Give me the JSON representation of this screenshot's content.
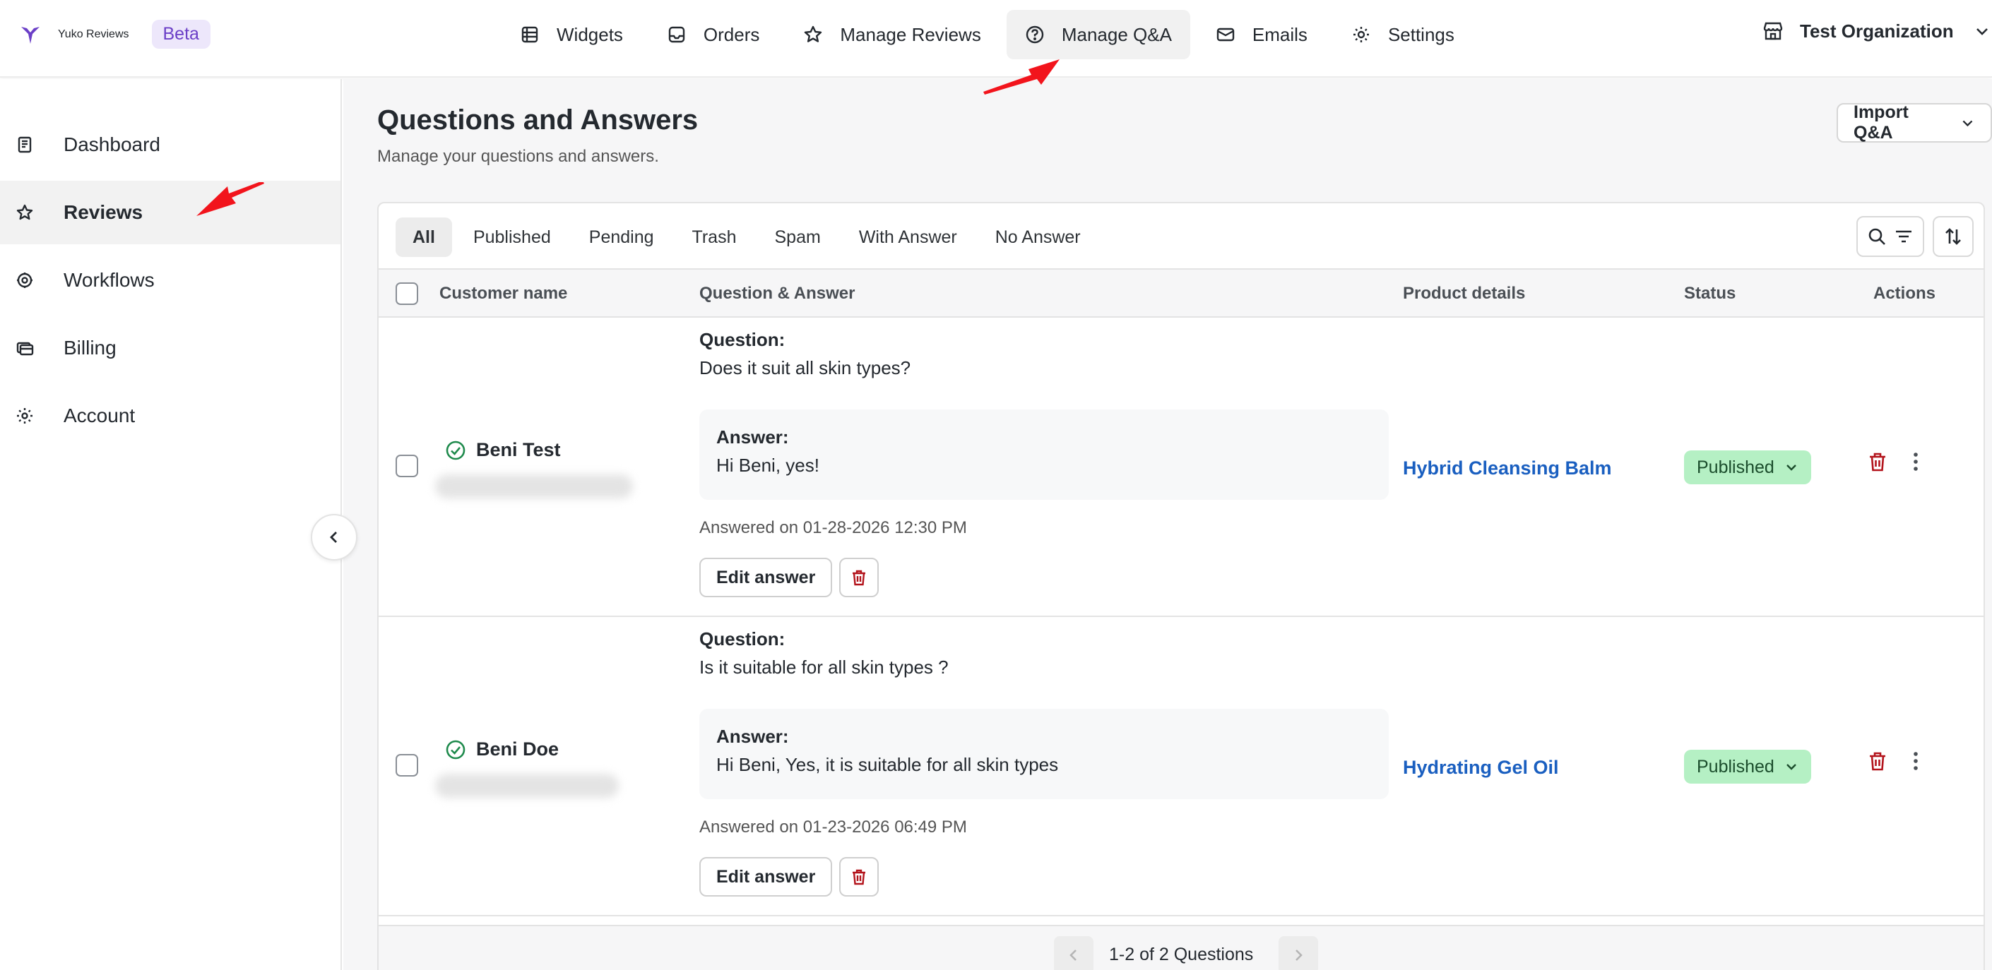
{
  "app": {
    "name": "Yuko Reviews",
    "badge": "Beta"
  },
  "nav": [
    {
      "label": "Widgets",
      "icon": "widgets-icon"
    },
    {
      "label": "Orders",
      "icon": "inbox-icon"
    },
    {
      "label": "Manage Reviews",
      "icon": "star-icon"
    },
    {
      "label": "Manage Q&A",
      "icon": "question-circle-icon",
      "active": true
    },
    {
      "label": "Emails",
      "icon": "mail-icon"
    },
    {
      "label": "Settings",
      "icon": "gear-icon"
    }
  ],
  "org": {
    "name": "Test Organization"
  },
  "sidebar": {
    "items": [
      {
        "label": "Dashboard",
        "icon": "dashboard-icon"
      },
      {
        "label": "Reviews",
        "icon": "star-icon",
        "active": true
      },
      {
        "label": "Workflows",
        "icon": "workflow-icon"
      },
      {
        "label": "Billing",
        "icon": "billing-icon"
      },
      {
        "label": "Account",
        "icon": "gear-icon"
      }
    ]
  },
  "page": {
    "title": "Questions and Answers",
    "subtitle": "Manage your questions and answers.",
    "import_label": "Import Q&A"
  },
  "tabs": [
    "All",
    "Published",
    "Pending",
    "Trash",
    "Spam",
    "With Answer",
    "No Answer"
  ],
  "table": {
    "headers": {
      "customer": "Customer name",
      "qa": "Question & Answer",
      "product": "Product details",
      "status": "Status",
      "actions": "Actions"
    },
    "rows": [
      {
        "customer": "Beni Test",
        "question_label": "Question:",
        "question": "Does it suit all skin types?",
        "answer_label": "Answer:",
        "answer": "Hi Beni, yes!",
        "answered_on": "Answered on 01-28-2026 12:30 PM",
        "edit_label": "Edit answer",
        "product": "Hybrid Cleansing Balm",
        "status": "Published"
      },
      {
        "customer": "Beni Doe",
        "question_label": "Question:",
        "question": "Is it suitable for all skin types ?",
        "answer_label": "Answer:",
        "answer": "Hi Beni, Yes, it is suitable for all skin types",
        "answered_on": "Answered on 01-23-2026 06:49 PM",
        "edit_label": "Edit answer",
        "product": "Hydrating Gel Oil",
        "status": "Published"
      }
    ]
  },
  "pagination": {
    "text": "1-2 of 2 Questions"
  },
  "colors": {
    "accent": "#6b3fc7",
    "link": "#1a5fc0",
    "published_bg": "#b5f0c4",
    "danger": "#b3131b",
    "annotation_arrow": "#f2141c"
  }
}
